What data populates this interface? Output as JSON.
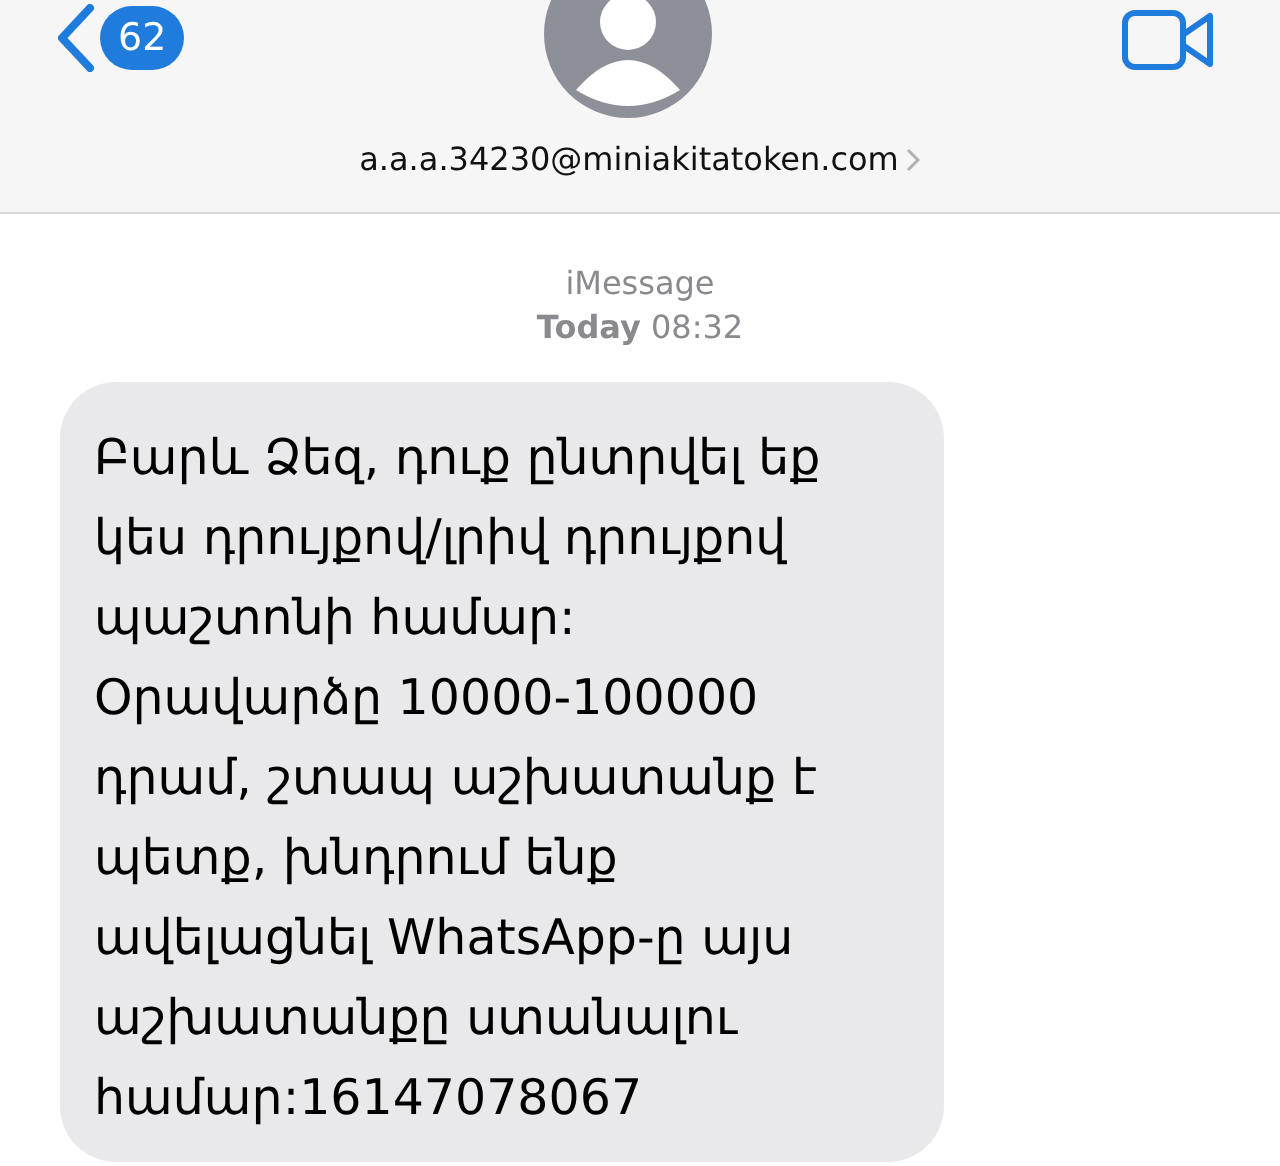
{
  "header": {
    "unread_count": "62",
    "contact": "a.a.a.34230@miniakitatoken.com"
  },
  "thread": {
    "service": "iMessage",
    "day": "Today",
    "time": "08:32"
  },
  "messages": [
    {
      "kind": "incoming",
      "text": "Բարև Ձեզ, դուք ընտրվել եք\nկես դրույքով/լրիվ դրույքով\nպաշտոնի համար:\nՕրավարձը 10000-100000\nդրամ, շտապ աշխատանք է\nպետք, խնդրում ենք\nավելացնել WhatsApp-ը այս\nաշխատանքը ստանալու\nհամար:16147078067"
    }
  ]
}
